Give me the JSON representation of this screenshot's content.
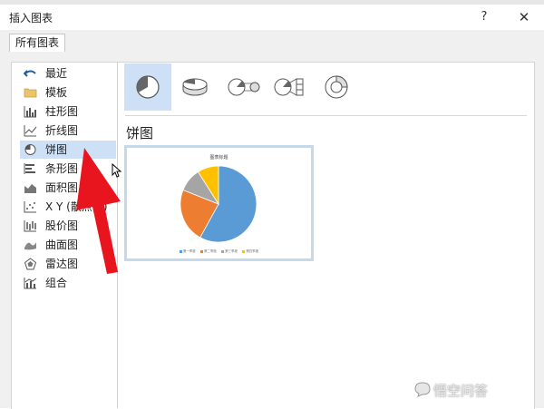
{
  "window": {
    "title": "插入图表",
    "help_label": "?",
    "close_label": "✕"
  },
  "tabs": [
    {
      "label": "所有图表"
    }
  ],
  "sidebar": {
    "items": [
      {
        "label": "最近",
        "icon": "undo-icon"
      },
      {
        "label": "模板",
        "icon": "folder-icon"
      },
      {
        "label": "柱形图",
        "icon": "column-chart-icon"
      },
      {
        "label": "折线图",
        "icon": "line-chart-icon"
      },
      {
        "label": "饼图",
        "icon": "pie-chart-icon",
        "selected": true
      },
      {
        "label": "条形图",
        "icon": "bar-chart-icon"
      },
      {
        "label": "面积图",
        "icon": "area-chart-icon"
      },
      {
        "label": "X Y (散点图)",
        "icon": "scatter-chart-icon"
      },
      {
        "label": "股价图",
        "icon": "stock-chart-icon"
      },
      {
        "label": "曲面图",
        "icon": "surface-chart-icon"
      },
      {
        "label": "雷达图",
        "icon": "radar-chart-icon"
      },
      {
        "label": "组合",
        "icon": "combo-chart-icon"
      }
    ]
  },
  "subtypes": [
    {
      "icon": "pie-icon",
      "selected": true
    },
    {
      "icon": "3d-pie-icon"
    },
    {
      "icon": "pie-of-pie-icon"
    },
    {
      "icon": "bar-of-pie-icon"
    },
    {
      "icon": "doughnut-icon"
    }
  ],
  "section": {
    "title": "饼图"
  },
  "preview": {
    "title": "图表标题",
    "legend": [
      "第一季度",
      "第二季度",
      "第三季度",
      "第四季度"
    ]
  },
  "chart_data": {
    "type": "pie",
    "title": "图表标题",
    "categories": [
      "第一季度",
      "第二季度",
      "第三季度",
      "第四季度"
    ],
    "values": [
      58,
      23,
      10,
      9
    ],
    "colors": [
      "#5b9bd5",
      "#ed7d31",
      "#a5a5a5",
      "#ffc000"
    ]
  },
  "watermark": {
    "text": "悟空问答"
  },
  "colors": {
    "selected_bg": "#cde0f5",
    "accent_arrow": "#e8141e"
  }
}
